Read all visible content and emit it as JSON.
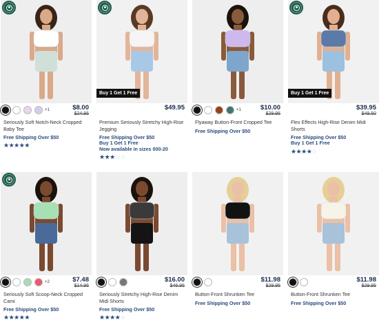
{
  "colors": {
    "accent": "#2a4a7a",
    "price": "#1a2a4d",
    "eco": "#1f5c4b"
  },
  "products": [
    {
      "name": "Seriously Soft Notch-Neck Cropped Baby Tee",
      "price": "$8.00",
      "was_price": "$24.95",
      "swatches": [
        "#111111",
        "#ffffff",
        "#e9d6ea",
        "#d6cdee"
      ],
      "more": "+1",
      "ship": [
        "Free Shipping Over $50"
      ],
      "rating": 5,
      "eco": true,
      "badge": "",
      "photo": {
        "bg": "#eeeeee",
        "skin": "#d9a98a",
        "hair": "#3a2418",
        "top": "#ffffff",
        "bottom": "#cfe0d8"
      }
    },
    {
      "name": "Premium Seriously Stretchy High-Rise Jegging",
      "price": "$49.95",
      "was_price": "",
      "swatches": [],
      "more": "",
      "ship": [
        "Free Shipping Over $50",
        "Buy 1 Get 1 Free",
        "Now available in sizes 000-20"
      ],
      "rating": 3,
      "eco": true,
      "badge": "Buy 1 Get 1 Free",
      "photo": {
        "bg": "#f1f1f1",
        "skin": "#e2b59a",
        "hair": "#5a3a22",
        "top": "#f5f5f5",
        "bottom": "#a9c8e6"
      }
    },
    {
      "name": "Flyaway Button-Front Cropped Tee",
      "price": "$10.00",
      "was_price": "$29.95",
      "swatches": [
        "#111111",
        "#ffffff",
        "#9c3f18",
        "#3f7670"
      ],
      "more": "+1",
      "ship": [
        "Free Shipping Over $50"
      ],
      "rating": 0,
      "eco": false,
      "badge": "",
      "photo": {
        "bg": "#eeeeee",
        "skin": "#8a5a3c",
        "hair": "#1b120c",
        "top": "#cdb9ee",
        "bottom": "#7ea6cc"
      }
    },
    {
      "name": "Flex Effects High-Rise Denim Midi Shorts",
      "price": "$39.95",
      "was_price": "$49.50",
      "swatches": [],
      "more": "",
      "ship": [
        "Free Shipping Over $50",
        "Buy 1 Get 1 Free"
      ],
      "rating": 4,
      "eco": true,
      "badge": "Buy 1 Get 1 Free",
      "photo": {
        "bg": "#f1f1f1",
        "skin": "#e0b090",
        "hair": "#4a2c1c",
        "top": "#5a7aa8",
        "bottom": "#9cc0e0"
      }
    },
    {
      "name": "Seriously Soft Scoop-Neck Cropped Cami",
      "price": "$7.48",
      "was_price": "$14.95",
      "swatches": [
        "#111111",
        "#ffffff",
        "#a8dcb4",
        "#ea5a6e"
      ],
      "more": "+2",
      "ship": [
        "Free Shipping Over $50"
      ],
      "rating": 5,
      "eco": true,
      "badge": "",
      "photo": {
        "bg": "#eeeeee",
        "skin": "#7a4a30",
        "hair": "#1b120c",
        "top": "#a8e0b6",
        "bottom": "#4a6a9a"
      }
    },
    {
      "name": "Seriously Stretchy High-Rise Denim Midi Shorts",
      "price": "$16.00",
      "was_price": "$46.95",
      "swatches": [
        "#111111",
        "#ffffff",
        "#777777"
      ],
      "more": "",
      "ship": [
        "Free Shipping Over $50"
      ],
      "rating": 4,
      "eco": false,
      "badge": "",
      "photo": {
        "bg": "#eeeeee",
        "skin": "#7a4a30",
        "hair": "#1b120c",
        "top": "#3a3a3a",
        "bottom": "#141414"
      }
    },
    {
      "name": "Button-Front Shrunken Tee",
      "price": "$11.98",
      "was_price": "$29.95",
      "swatches": [
        "#111111",
        "#ffffff"
      ],
      "more": "",
      "ship": [
        "Free Shipping Over $50"
      ],
      "rating": 0,
      "eco": false,
      "badge": "",
      "photo": {
        "bg": "#f1f1f1",
        "skin": "#eac0a6",
        "hair": "#e6cf96",
        "top": "#121212",
        "bottom": "#a8c2da"
      }
    },
    {
      "name": "Button-Front Shrunken Tee",
      "price": "$11.98",
      "was_price": "$29.95",
      "swatches": [
        "#111111",
        "#ffffff"
      ],
      "more": "",
      "ship": [
        "Free Shipping Over $50"
      ],
      "rating": 0,
      "eco": false,
      "badge": "",
      "photo": {
        "bg": "#f1f1f1",
        "skin": "#eac0a6",
        "hair": "#e6cf96",
        "top": "#f6f3e8",
        "bottom": "#a8c2da"
      }
    }
  ]
}
